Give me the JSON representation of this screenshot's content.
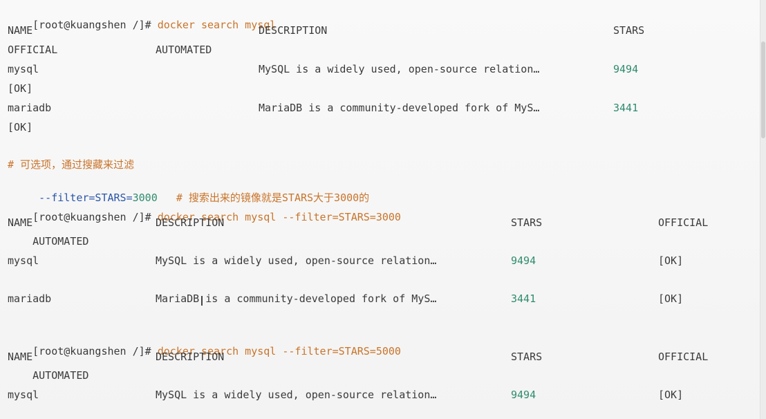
{
  "terminal": {
    "lines": [
      {
        "prompt": "[root@kuangshen /]# ",
        "cmd": "docker search mysql"
      },
      {
        "cols": [
          "NAME",
          "DESCRIPTION",
          "STARS"
        ]
      },
      {
        "cols": [
          "OFFICIAL",
          "AUTOMATED"
        ]
      },
      {
        "name": "mysql",
        "desc": "MySQL is a widely used, open-source relation…",
        "stars": "9494"
      },
      {
        "text": "[OK]"
      },
      {
        "name": "mariadb",
        "desc": "MariaDB is a community-developed fork of MyS…",
        "stars": "3441"
      },
      {
        "text": "[OK]"
      },
      {
        "comment": "# 可选项，通过搜藏来过滤"
      },
      {
        "opt": " --filter",
        "eq": "=STARS=",
        "val": "3000",
        "comment": "   # 搜索出来的镜像就是STARS大于3000的"
      },
      {
        "prompt": "[root@kuangshen /]# ",
        "cmd": "docker search mysql --filter=STARS=3000"
      },
      {
        "cols": [
          "NAME",
          "DESCRIPTION",
          "STARS",
          "OFFICIAL"
        ]
      },
      {
        "text": "    AUTOMATED"
      },
      {
        "name": "mysql",
        "desc": "MySQL is a widely used, open-source relation…",
        "stars": "9494",
        "official": "[OK]"
      },
      {
        "name": "mariadb",
        "desc": "MariaDB is a community-developed fork of MyS…",
        "stars": "3441",
        "official": "[OK]"
      },
      {
        "prompt": "[root@kuangshen /]# ",
        "cmd": "docker search mysql --filter=STARS=5000"
      },
      {
        "cols": [
          "NAME",
          "DESCRIPTION",
          "STARS",
          "OFFICIAL"
        ]
      },
      {
        "text": "    AUTOMATED"
      },
      {
        "name": "mysql",
        "desc": "MySQL is a widely used, open-source relation…",
        "stars": "9494",
        "official": "[OK]"
      }
    ]
  }
}
